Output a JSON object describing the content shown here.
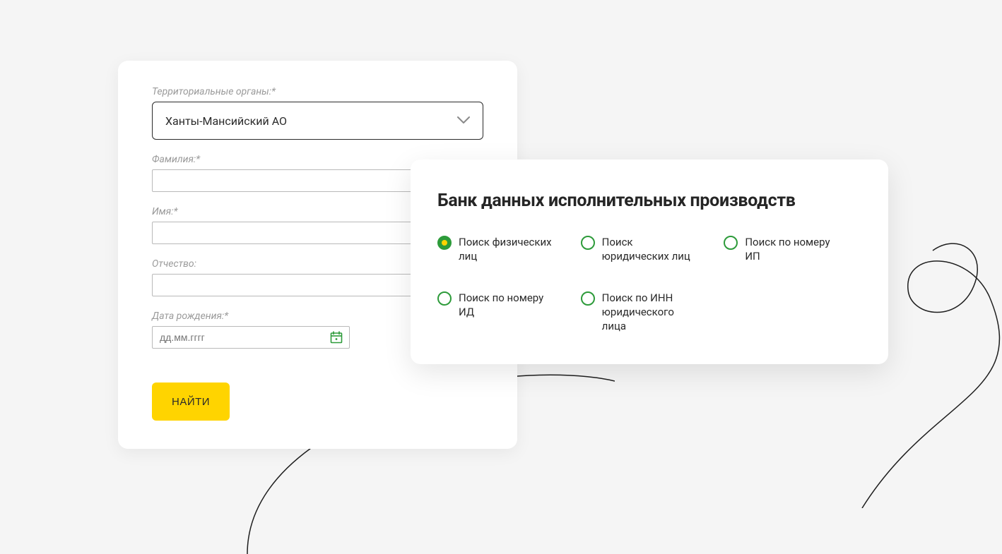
{
  "form": {
    "territory": {
      "label": "Территориальные органы:*",
      "selected": "Ханты-Мансийский АО"
    },
    "surname": {
      "label": "Фамилия:*",
      "value": ""
    },
    "name": {
      "label": "Имя:*",
      "value": ""
    },
    "patronymic": {
      "label": "Отчество:",
      "value": ""
    },
    "dob": {
      "label": "Дата рождения:*",
      "placeholder": "дд.мм.гггг",
      "value": ""
    },
    "submit_label": "НАЙТИ"
  },
  "search_panel": {
    "title": "Банк данных исполнительных производств",
    "options": [
      "Поиск физических лиц",
      "Поиск юридических лиц",
      "Поиск по номеру ИП",
      "Поиск по номеру ИД",
      "Поиск по ИНН юридического лица"
    ],
    "selected_index": 0
  },
  "colors": {
    "accent_yellow": "#ffd400",
    "accent_green": "#2d9b3a",
    "text": "#2a2a2a",
    "muted": "#9a9a9a",
    "bg": "#f5f5f5"
  }
}
